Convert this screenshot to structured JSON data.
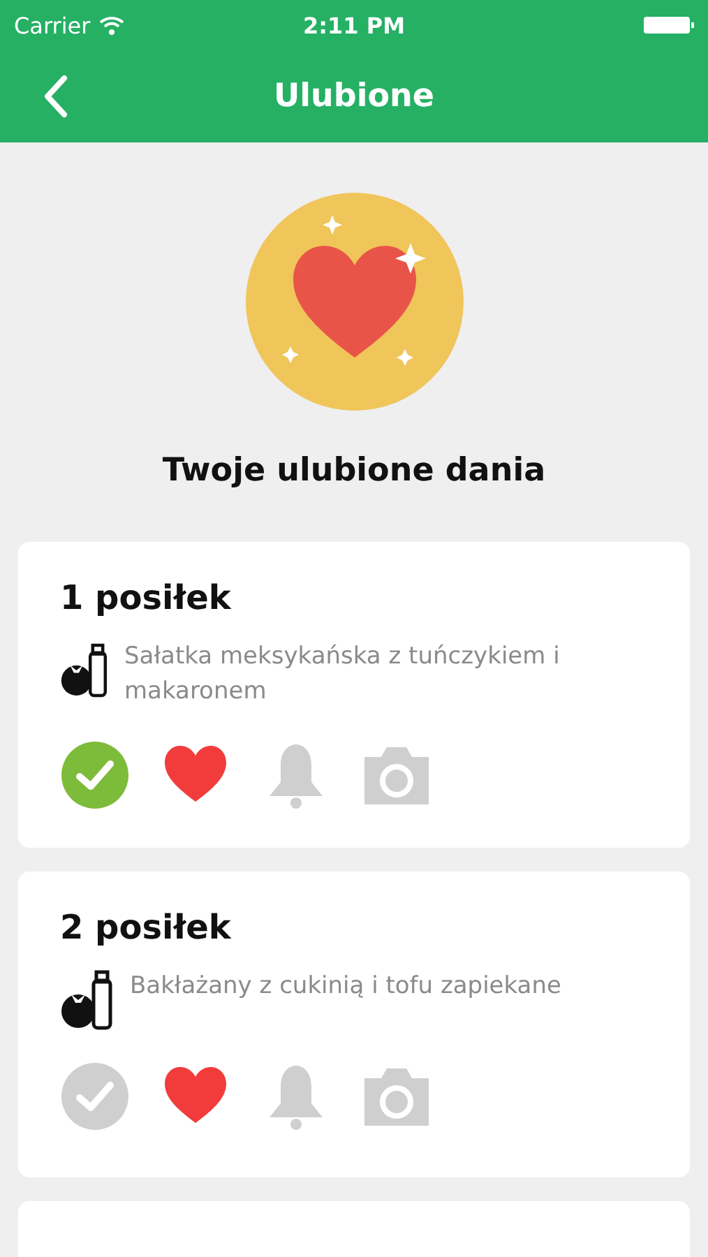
{
  "status_bar": {
    "carrier": "Carrier",
    "time": "2:11 PM"
  },
  "nav": {
    "title": "Ulubione"
  },
  "header": {
    "title": "Twoje ulubione dania"
  },
  "meals": [
    {
      "title": "1 posiłek",
      "dish": "Sałatka meksykańska z tuńczykiem i makaronem",
      "done": true,
      "favorite": true
    },
    {
      "title": "2 posiłek",
      "dish": "Bakłażany z cukinią i tofu zapiekane",
      "done": false,
      "favorite": true
    }
  ]
}
